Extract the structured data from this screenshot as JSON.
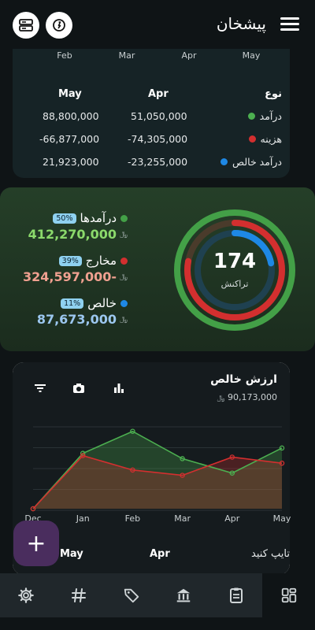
{
  "header": {
    "title": "پیشخان"
  },
  "top_card": {
    "months": [
      "Feb",
      "Mar",
      "Apr",
      "May"
    ],
    "headers": {
      "type": "نوع",
      "col1": "Apr",
      "col2": "May"
    },
    "rows": [
      {
        "label": "درآمد",
        "color": "#4caf50",
        "apr": "51,050,000",
        "may": "88,800,000"
      },
      {
        "label": "هزینه",
        "color": "#d32f2f",
        "apr": "-74,305,000",
        "may": "-66,877,000"
      },
      {
        "label": "درآمد خالص",
        "color": "#1e88e5",
        "apr": "-23,255,000",
        "may": "21,923,000"
      }
    ]
  },
  "summary": {
    "total": "174",
    "total_label": "تراکنش",
    "items": [
      {
        "label": "درآمدها",
        "badge": "50%",
        "value": "412,270,000",
        "color": "#43a047",
        "value_color": "#8bd96b",
        "percent": 50
      },
      {
        "label": "مخارج",
        "badge": "39%",
        "value": "-324,597,000",
        "color": "#d32f2f",
        "value_color": "#f0a090",
        "percent": 39
      },
      {
        "label": "خالص",
        "badge": "11%",
        "value": "87,673,000",
        "color": "#1e88e5",
        "value_color": "#9cc7ef",
        "percent": 11
      }
    ],
    "currency": "﷼"
  },
  "chart_data": {
    "type": "line",
    "title": "ارزش خالص",
    "subtitle": "90,173,000",
    "x": [
      "Dec",
      "Jan",
      "Feb",
      "Mar",
      "Apr",
      "May"
    ],
    "series": [
      {
        "name": "income",
        "color": "#4caf50",
        "values": [
          0,
          73,
          102,
          66,
          47,
          80
        ]
      },
      {
        "name": "expense",
        "color": "#d32f2f",
        "values": [
          0,
          70,
          51,
          44,
          68,
          60
        ]
      }
    ],
    "ylim": [
      0,
      110
    ]
  },
  "bottom_row": {
    "label": "تایپ کنید",
    "col1": "Apr",
    "col2": "May"
  },
  "fab_label": "+",
  "colors": {
    "accent": "#4a2d5e",
    "navbar": "#20272b"
  }
}
